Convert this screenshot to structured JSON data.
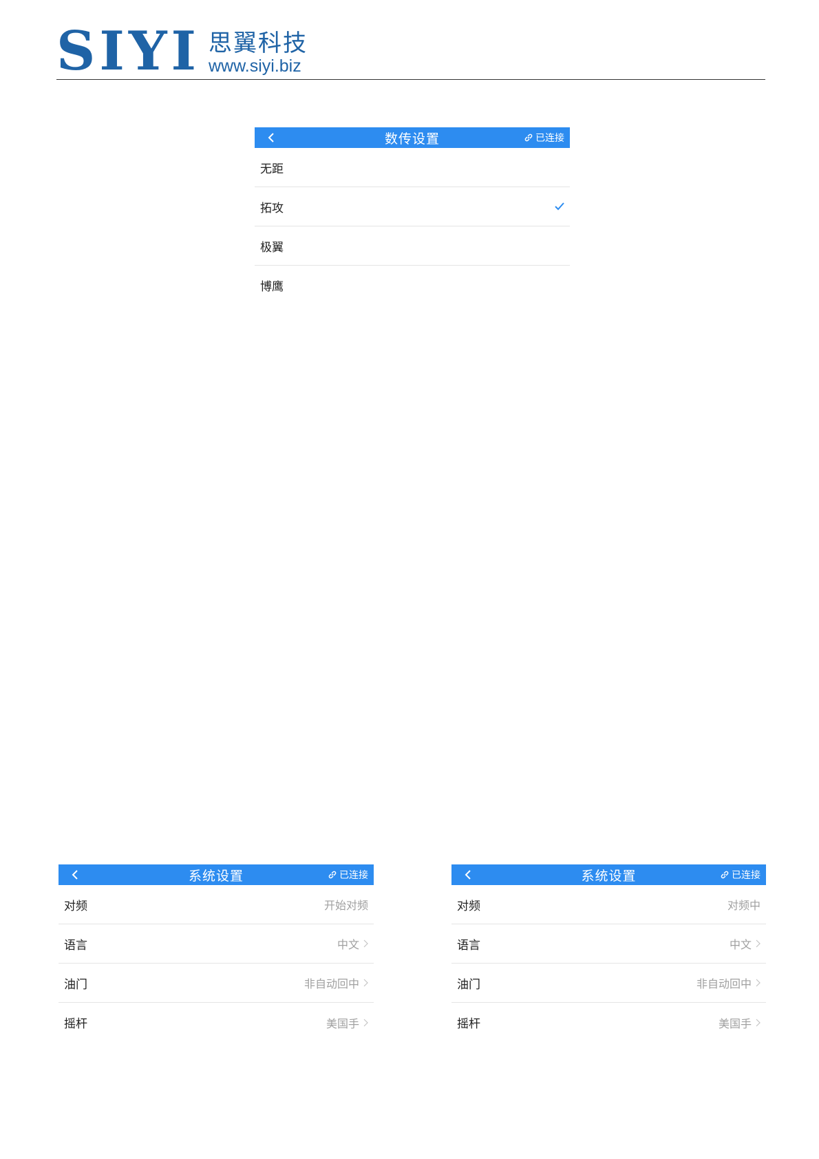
{
  "header": {
    "logo_text": "SIYI",
    "logo_cn": "思翼科技",
    "logo_url": "www.siyi.biz"
  },
  "colors": {
    "accent": "#2d8cf0",
    "brand": "#1f63a6"
  },
  "datalink_screen": {
    "title": "数传设置",
    "status": "已连接",
    "status_icon": "link-icon",
    "back_icon": "chevron-left-icon",
    "options": [
      {
        "label": "无距",
        "selected": false
      },
      {
        "label": "拓攻",
        "selected": true
      },
      {
        "label": "极翼",
        "selected": false
      },
      {
        "label": "博鹰",
        "selected": false
      }
    ]
  },
  "system_screen_left": {
    "title": "系统设置",
    "status": "已连接",
    "rows": [
      {
        "label": "对频",
        "value": "开始对频",
        "chevron": false
      },
      {
        "label": "语言",
        "value": "中文",
        "chevron": true
      },
      {
        "label": "油门",
        "value": "非自动回中",
        "chevron": true
      },
      {
        "label": "摇杆",
        "value": "美国手",
        "chevron": true
      }
    ]
  },
  "system_screen_right": {
    "title": "系统设置",
    "status": "已连接",
    "rows": [
      {
        "label": "对频",
        "value": "对频中",
        "chevron": false
      },
      {
        "label": "语言",
        "value": "中文",
        "chevron": true
      },
      {
        "label": "油门",
        "value": "非自动回中",
        "chevron": true
      },
      {
        "label": "摇杆",
        "value": "美国手",
        "chevron": true
      }
    ]
  }
}
